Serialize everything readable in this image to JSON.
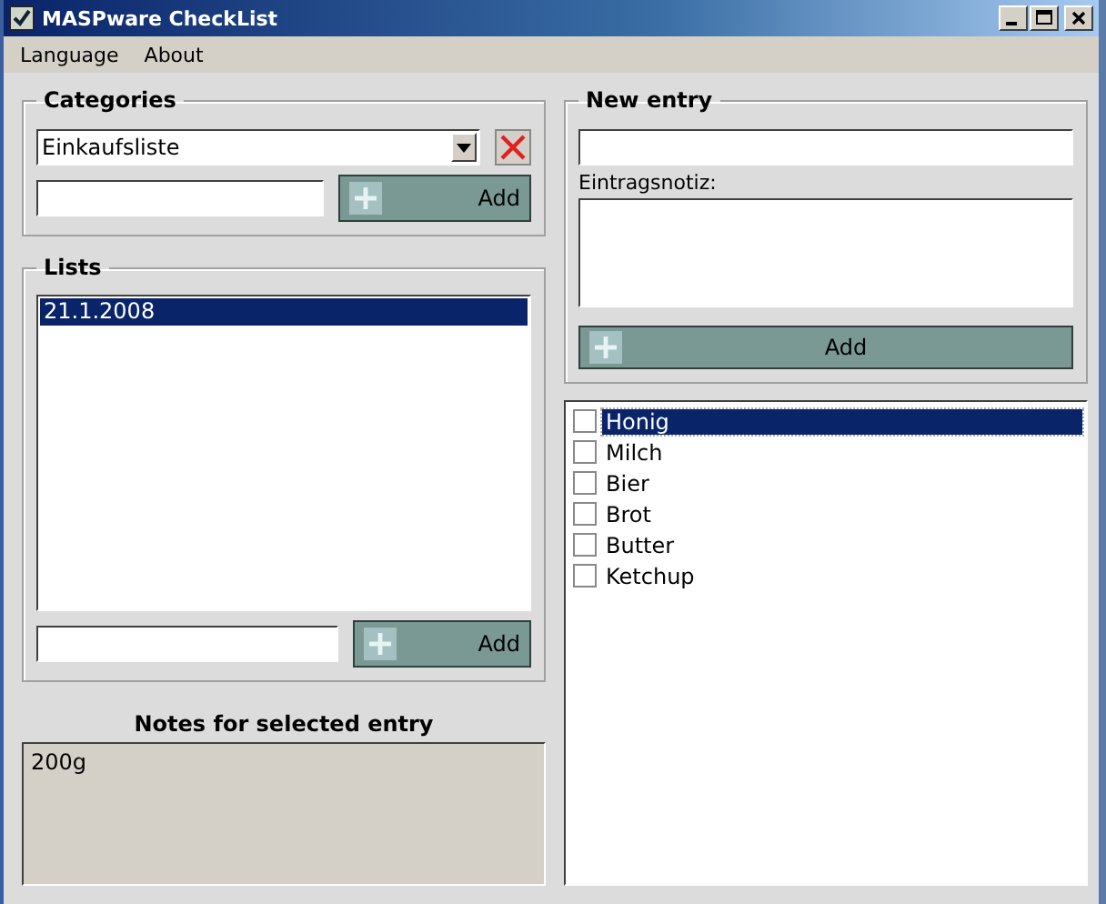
{
  "window": {
    "title": "MASPware CheckList"
  },
  "menu": [
    "Language",
    "About"
  ],
  "categories": {
    "title": "Categories",
    "selected_value": "Einkaufsliste",
    "add_button": "Add"
  },
  "lists": {
    "title": "Lists",
    "items": [
      {
        "label": "21.1.2008",
        "selected": true
      }
    ],
    "add_button": "Add"
  },
  "notes": {
    "title": "Notes for selected entry",
    "value": "200g"
  },
  "new_entry": {
    "title": "New entry",
    "note_label": "Eintragsnotiz:",
    "add_button": "Add"
  },
  "entries": [
    {
      "label": "Honig",
      "checked": false,
      "selected": true
    },
    {
      "label": "Milch",
      "checked": false,
      "selected": false
    },
    {
      "label": "Bier",
      "checked": false,
      "selected": false
    },
    {
      "label": "Brot",
      "checked": false,
      "selected": false
    },
    {
      "label": "Butter",
      "checked": false,
      "selected": false
    },
    {
      "label": "Ketchup",
      "checked": false,
      "selected": false
    }
  ]
}
